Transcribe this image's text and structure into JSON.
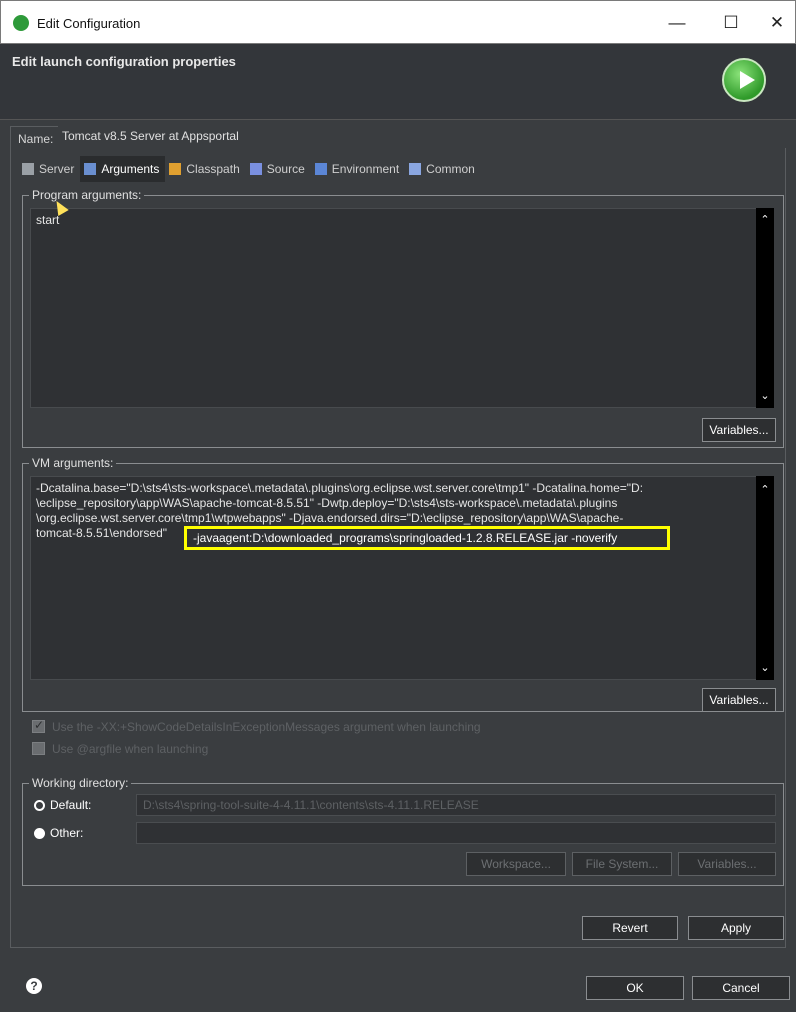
{
  "window": {
    "title": "Edit Configuration",
    "minimize": "—",
    "maximize": "☐",
    "close": "✕"
  },
  "header": {
    "title": "Edit launch configuration properties",
    "icon": "run-icon"
  },
  "name": {
    "label": "Name:",
    "value": "Tomcat v8.5 Server at Appsportal"
  },
  "tabs": [
    {
      "label": "Server",
      "icon": "server-icon",
      "color": "#9aa0a6"
    },
    {
      "label": "Arguments",
      "icon": "arguments-icon",
      "color": "#6a8fd0",
      "active": true
    },
    {
      "label": "Classpath",
      "icon": "classpath-icon",
      "color": "#e0a030"
    },
    {
      "label": "Source",
      "icon": "source-icon",
      "color": "#7a90e0"
    },
    {
      "label": "Environment",
      "icon": "environment-icon",
      "color": "#5b86d6"
    },
    {
      "label": "Common",
      "icon": "common-icon",
      "color": "#8aa6e0"
    }
  ],
  "program_args": {
    "legend": "Program arguments:",
    "value": "start",
    "variables_label": "Variables..."
  },
  "vm_args": {
    "legend": "VM arguments:",
    "lines": [
      "-Dcatalina.base=\"D:\\sts4\\sts-workspace\\.metadata\\.plugins\\org.eclipse.wst.server.core\\tmp1\" -Dcatalina.home=\"D:",
      "\\eclipse_repository\\app\\WAS\\apache-tomcat-8.5.51\" -Dwtp.deploy=\"D:\\sts4\\sts-workspace\\.metadata\\.plugins",
      "\\org.eclipse.wst.server.core\\tmp1\\wtpwebapps\" -Djava.endorsed.dirs=\"D:\\eclipse_repository\\app\\WAS\\apache-",
      "tomcat-8.5.51\\endorsed\""
    ],
    "highlight": "-javaagent:D:\\downloaded_programs\\springloaded-1.2.8.RELEASE.jar -noverify",
    "variables_label": "Variables...",
    "highlight_color": "#ffff00"
  },
  "options": {
    "show_code_details": "Use the -XX:+ShowCodeDetailsInExceptionMessages argument when launching",
    "use_argfile": "Use @argfile when launching"
  },
  "working_dir": {
    "legend": "Working directory:",
    "default_label": "Default:",
    "default_value": "D:\\sts4\\spring-tool-suite-4-4.11.1\\contents\\sts-4.11.1.RELEASE",
    "other_label": "Other:",
    "other_value": "",
    "workspace_label": "Workspace...",
    "filesystem_label": "File System...",
    "variables_label": "Variables..."
  },
  "footer": {
    "revert_label": "Revert",
    "apply_label": "Apply",
    "ok_label": "OK",
    "cancel_label": "Cancel",
    "help_glyph": "?"
  }
}
